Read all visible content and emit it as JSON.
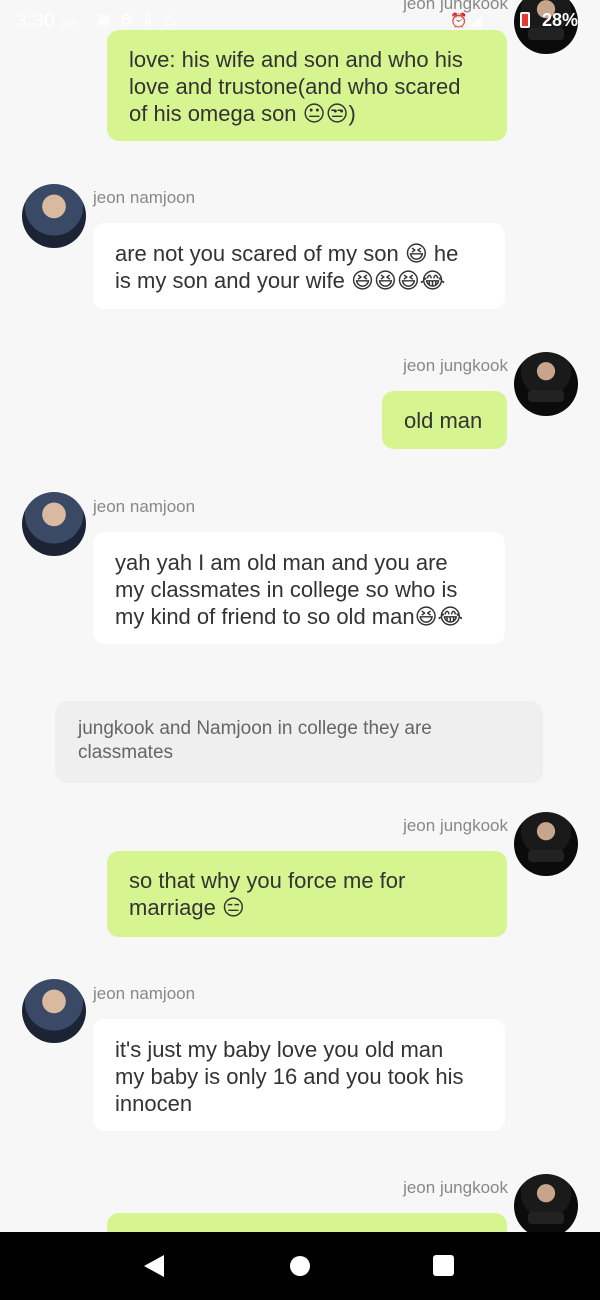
{
  "status_bar": {
    "time": "3:30",
    "ampm": "am",
    "icons": [
      "image-icon",
      "gear-icon",
      "download-icon",
      "warning-icon"
    ],
    "right_icons": [
      "alarm-icon",
      "wifi-icon"
    ],
    "battery": "28%"
  },
  "chat": {
    "messages": [
      {
        "sender": "jeon jungkook",
        "side": "right",
        "show_name": true,
        "text": "love: his wife and son and who his\nlove and trustone(and who scared\nof his omega son 😐😒)"
      },
      {
        "sender": "jeon namjoon",
        "side": "left",
        "show_name": true,
        "text": "are not you scared of my son 😆 he\nis my son and your wife 😆😆😆😂"
      },
      {
        "sender": "jeon jungkook",
        "side": "right",
        "show_name": true,
        "text": "old man"
      },
      {
        "sender": "jeon namjoon",
        "side": "left",
        "show_name": true,
        "text": "yah yah I am old man and you are\nmy classmates in college so who is\nmy kind of friend to so old man😆😂"
      },
      {
        "narration": "jungkook and Namjoon in college they are\nclassmates"
      },
      {
        "sender": "jeon jungkook",
        "side": "right",
        "show_name": true,
        "text": "so that  why you force me for\nmarriage 😑"
      },
      {
        "sender": "jeon namjoon",
        "side": "left",
        "show_name": true,
        "text": "it's just my baby love you old man\nmy baby is only 16 and you took his\ninnocen"
      },
      {
        "sender": "jeon jungkook",
        "side": "right",
        "show_name": true,
        "text": ""
      }
    ]
  },
  "nav_bar": {
    "buttons": [
      "back-icon",
      "home-icon",
      "recents-icon"
    ]
  }
}
